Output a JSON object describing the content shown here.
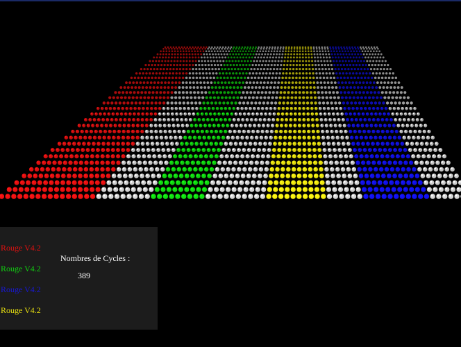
{
  "game": {
    "board": {
      "tile_color": "#c8c8c8",
      "background_color": "#000000",
      "stripes": [
        {
          "color_name": "red",
          "color": "#e01010"
        },
        {
          "color_name": "gray",
          "color": "#c8c8c8"
        },
        {
          "color_name": "green",
          "color": "#10d010"
        },
        {
          "color_name": "gray",
          "color": "#c8c8c8"
        },
        {
          "color_name": "yellow",
          "color": "#e8e010"
        },
        {
          "color_name": "gray",
          "color": "#c8c8c8"
        },
        {
          "color_name": "blue",
          "color": "#1010e0"
        },
        {
          "color_name": "gray",
          "color": "#c8c8c8"
        }
      ]
    },
    "players": [
      {
        "label": "Rouge V4.2",
        "color": "#e01010"
      },
      {
        "label": "Rouge V4.2",
        "color": "#10d010"
      },
      {
        "label": "Rouge V4.2",
        "color": "#1818d8"
      },
      {
        "label": "Rouge V4.2",
        "color": "#e8e010"
      }
    ],
    "cycles": {
      "label": "Nombres de Cycles :",
      "value": "389"
    }
  }
}
